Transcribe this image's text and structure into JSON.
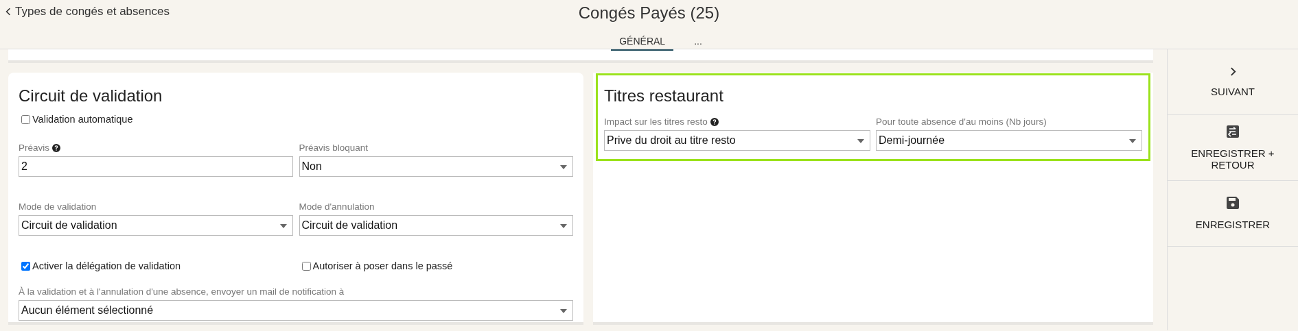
{
  "header": {
    "back_link": "Types de congés et absences",
    "title": "Congés Payés (25)",
    "tabs": [
      {
        "label": "GÉNÉRAL",
        "selected": true
      },
      {
        "label": "...",
        "selected": false
      }
    ]
  },
  "validation_card": {
    "title": "Circuit de validation",
    "auto_validation": {
      "label": "Validation automatique",
      "checked": false
    },
    "field_rows": [
      [
        {
          "kind": "input",
          "label": "Préavis",
          "help": true,
          "value": "2"
        },
        {
          "kind": "select",
          "label": "Préavis bloquant",
          "help": false,
          "value": "Non"
        }
      ],
      [
        {
          "kind": "select",
          "label": "Mode de validation",
          "help": false,
          "value": "Circuit de validation"
        },
        {
          "kind": "select",
          "label": "Mode d'annulation",
          "help": false,
          "value": "Circuit de validation"
        }
      ]
    ],
    "options": [
      {
        "label": "Activer la délégation de validation",
        "checked": true
      },
      {
        "label": "Autoriser à poser dans le passé",
        "checked": false
      }
    ],
    "notification": {
      "kind": "select",
      "label": "À la validation et à l'annulation d'une absence, envoyer un mail de notification à",
      "help": false,
      "value": "Aucun élément sélectionné"
    }
  },
  "restaurant_card": {
    "title": "Titres restaurant",
    "highlighted": true,
    "fields": [
      {
        "kind": "select",
        "label": "Impact sur les titres resto",
        "help": true,
        "value": "Prive du droit au titre resto"
      },
      {
        "kind": "select",
        "label": "Pour toute absence d'au moins (Nb jours)",
        "help": false,
        "value": "Demi-journée"
      }
    ]
  },
  "actions": [
    {
      "kind": "next",
      "label": "SUIVANT"
    },
    {
      "kind": "save_back",
      "label": "ENREGISTRER + RETOUR"
    },
    {
      "kind": "save",
      "label": "ENREGISTRER"
    }
  ]
}
